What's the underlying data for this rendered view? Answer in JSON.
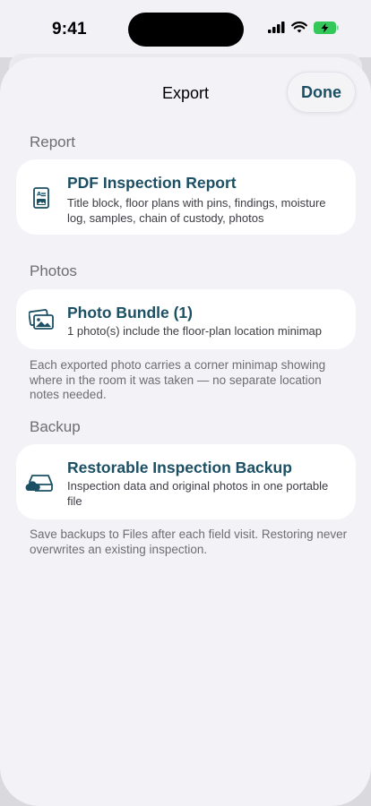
{
  "status_bar": {
    "time": "9:41"
  },
  "sheet": {
    "title": "Export",
    "done_label": "Done"
  },
  "sections": {
    "report": {
      "header": "Report",
      "card": {
        "title": "PDF Inspection Report",
        "subtitle": "Title block, floor plans with pins, findings, moisture log, samples, chain of custody, photos",
        "icon": "document-photo-icon"
      }
    },
    "photos": {
      "header": "Photos",
      "card": {
        "title": "Photo Bundle (1)",
        "subtitle": "1 photo(s) include the floor-plan location minimap",
        "icon": "photo-stack-icon"
      },
      "footer": "Each exported photo carries a corner minimap showing where in the room it was taken — no separate location notes needed."
    },
    "backup": {
      "header": "Backup",
      "card": {
        "title": "Restorable Inspection Backup",
        "subtitle": "Inspection data and original photos in one portable file",
        "icon": "drive-cloud-icon"
      },
      "footer": "Save backups to Files after each field visit. Restoring never overwrites an existing inspection."
    }
  },
  "colors": {
    "accent": "#1b4f64",
    "battery": "#34c759",
    "sheet_bg": "#f2f2f7"
  }
}
